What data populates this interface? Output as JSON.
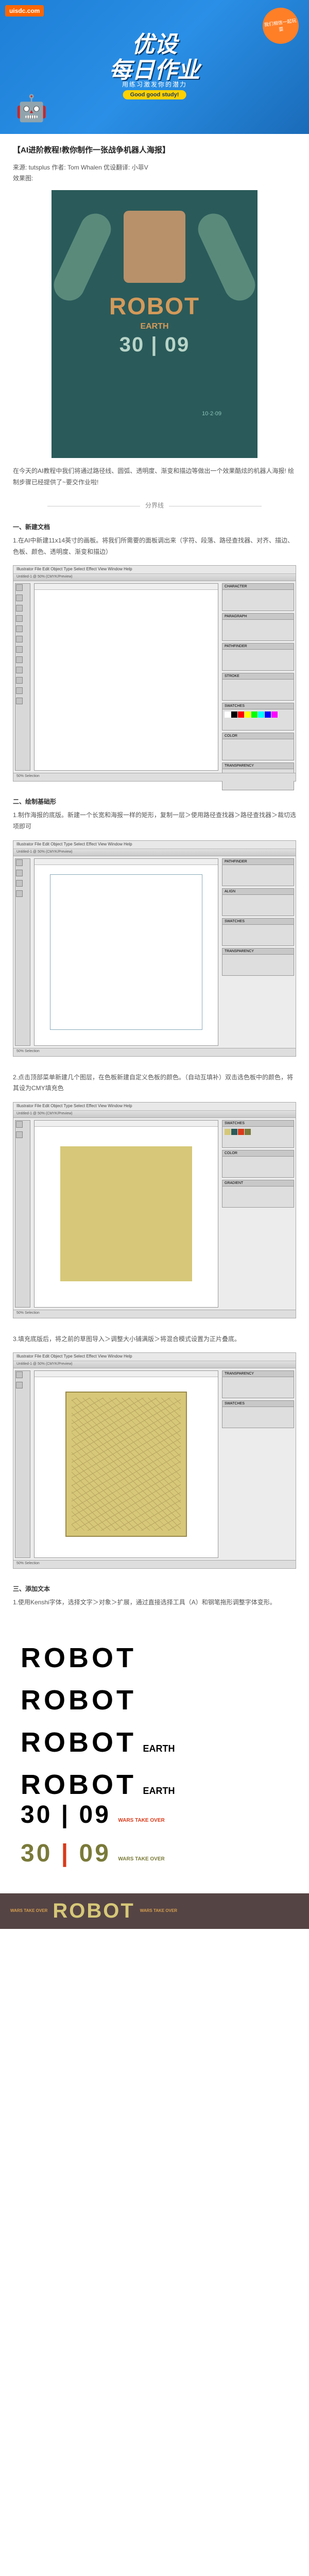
{
  "banner": {
    "logo": "uisdc.com",
    "badge": "我们相信一起玩耍",
    "title": "优设",
    "subtitle": "每日作业",
    "tagline": "用练习激发你的潜力",
    "pill": "Good good study!"
  },
  "article": {
    "title": "【AI进阶教程!教你制作一张战争机器人海报】",
    "source_label": "来源: ",
    "source": "tutsplus",
    "author_label": " 作者: ",
    "author": "Tom Whalen",
    "translator_label": " 优设翻译: ",
    "translator": "小菲V",
    "result_label": "效果图:"
  },
  "poster": {
    "robot": "ROBOT",
    "earth": "EARTH",
    "date_big": "30 | 09",
    "date_small": "10·2·09"
  },
  "intro": "在今天的AI教程中我们将通过路径线、圆弧、透明度、渐变和描边等做出一个效果酷炫的机器人海报! 绘制步骤已经提供了~要交作业啦!",
  "divider": "分界线",
  "section1": {
    "heading": "一、新建文档",
    "text": "1.在AI中新建11x14英寸的画板。将我们所需要的面板调出来（字符、段落、路径查找器、对齐、描边、色板、颜色、透明度、渐变和描边）"
  },
  "ai": {
    "menu": "Illustrator  File  Edit  Object  Type  Select  Effect  View  Window  Help",
    "doc_title": "Untitled-1 @ 50% (CMYK/Preview)",
    "status": "50%    Selection",
    "panels": {
      "character": "CHARACTER",
      "paragraph": "PARAGRAPH",
      "pathfinder": "PATHFINDER",
      "align": "ALIGN",
      "stroke": "STROKE",
      "swatches": "SWATCHES",
      "color": "COLOR",
      "transparency": "TRANSPARENCY",
      "gradient": "GRADIENT"
    }
  },
  "section2": {
    "heading": "二、绘制基础形",
    "text1": "1.制作海报的底版。新建一个长宽和海报一样的矩形，复制一层＞使用路径查找器＞路径查找器＞裁切选项即可",
    "text2": "2.点击顶部菜单新建几个图层，在色板新建自定义色板的颜色。（自动互填补）双击选色板中的颜色，将其设为CMY填充色",
    "text3": "3.填充底版后，将之前的草图导入＞调整大小铺满版＞将混合模式设置为正片叠底。"
  },
  "section3": {
    "heading": "三、添加文本",
    "text": "1.使用Kenshi字体，选择文字＞对象＞扩展，通过直接选择工具（A）和钢笔拖形调整字体变形。"
  },
  "typo": {
    "robot": "ROBOT",
    "earth": "EARTH",
    "num1": "30",
    "num2": "09",
    "small1": "WARS\nTAKE\nOVER",
    "small2": "WARS\nTAKE\nOVER",
    "small3": "WARS\nTAKE\nOVER"
  }
}
